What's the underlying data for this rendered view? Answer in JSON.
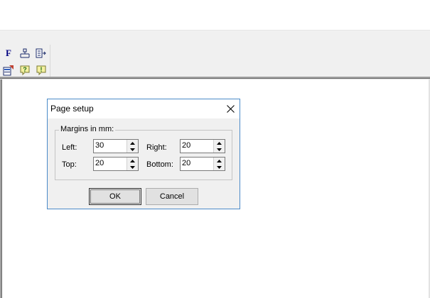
{
  "toolbar": {
    "icons": [
      {
        "name": "font-icon",
        "glyph": "F"
      },
      {
        "name": "structure-icon"
      },
      {
        "name": "export-icon"
      },
      {
        "name": "page-setup-icon"
      },
      {
        "name": "help-icon"
      },
      {
        "name": "info-icon"
      }
    ]
  },
  "dialog": {
    "title": "Page setup",
    "group_label": "Margins in mm:",
    "fields": {
      "left": {
        "label": "Left:",
        "value": "30"
      },
      "right": {
        "label": "Right:",
        "value": "20"
      },
      "top": {
        "label": "Top:",
        "value": "20"
      },
      "bottom": {
        "label": "Bottom:",
        "value": "20"
      }
    },
    "ok_label": "OK",
    "cancel_label": "Cancel"
  },
  "colors": {
    "dialog_border": "#4a8ac8",
    "dialog_bg": "#f0f0f0",
    "toolbar_bg": "#f0f0f0"
  }
}
